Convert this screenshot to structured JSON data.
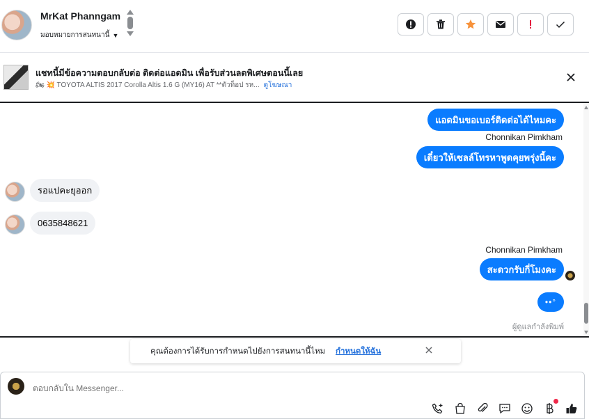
{
  "header": {
    "contact_name": "MrKat Phanngam",
    "assign_label": "มอบหมายการสนทนานี้",
    "actions": [
      {
        "name": "mark-spam-button",
        "icon": "alert-circle-icon"
      },
      {
        "name": "delete-button",
        "icon": "trash-icon"
      },
      {
        "name": "star-button",
        "icon": "star-icon"
      },
      {
        "name": "mark-unread-button",
        "icon": "envelope-icon"
      },
      {
        "name": "follow-up-button",
        "icon": "exclamation-icon"
      },
      {
        "name": "mark-done-button",
        "icon": "check-icon"
      }
    ]
  },
  "ad": {
    "title": "แชทนี้มีข้อความตอบกลับต่อ ติดต่อแอดมิน เพื่อรับส่วนลดพิเศษตอนนี้เลย",
    "subtitle": "🏍 💥 TOYOTA ALTIS 2017 Corolla Altis 1.6 G (MY16) AT **ตัวท็อป รห...",
    "link": "ดูโฆษณา"
  },
  "messages": {
    "out1": "แอดมินขอเบอร์ติดต่อได้ไหมคะ",
    "sender1": "Chonnikan Pimkham",
    "out2": "เดี๋ยวให้เซลล์โทรหาพูดคุยพรุ่งนี้คะ",
    "in1": "รอแปคะยุออก",
    "in2": "0635848621",
    "sender2": "Chonnikan Pimkham",
    "out3": "สะดวกรับกี่โมงคะ",
    "typing_dots": "••°",
    "typing_label": "ผู้ดูแลกำลังพิมพ์"
  },
  "notice": {
    "text": "คุณต้องการได้รับการกำหนดไปยังการสนทนานี้ไหม",
    "link": "กำหนดให้ฉัน"
  },
  "composer": {
    "placeholder": "ตอบกลับใน Messenger..."
  },
  "colors": {
    "accent": "#0a7cff",
    "star": "#f7923b",
    "danger": "#e41e3f",
    "link": "#216fdb"
  }
}
